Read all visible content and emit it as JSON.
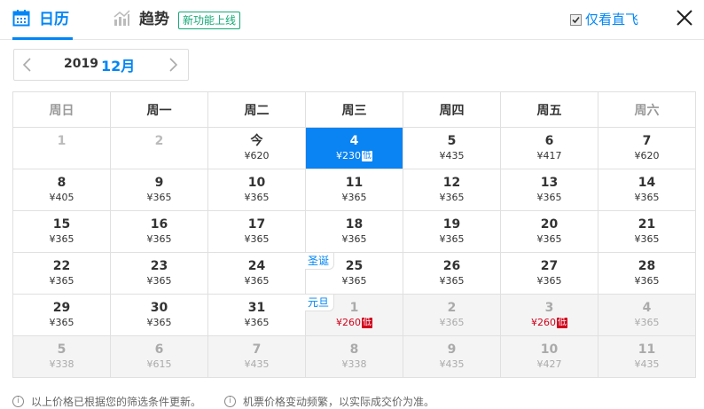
{
  "header": {
    "tab_calendar": "日历",
    "tab_trend": "趋势",
    "new_badge": "新功能上线",
    "direct_only_label": "仅看直飞",
    "direct_only_checked": true
  },
  "month_nav": {
    "year": "2019",
    "month": "12月"
  },
  "weekdays": [
    "周日",
    "周一",
    "周二",
    "周三",
    "周四",
    "周五",
    "周六"
  ],
  "weeks": [
    [
      {
        "day": "1",
        "price": ""
      },
      {
        "day": "2",
        "price": ""
      },
      {
        "day": "今",
        "price": "¥620"
      },
      {
        "day": "4",
        "price": "¥230",
        "low": "低"
      },
      {
        "day": "5",
        "price": "¥435"
      },
      {
        "day": "6",
        "price": "¥417"
      },
      {
        "day": "7",
        "price": "¥620"
      }
    ],
    [
      {
        "day": "8",
        "price": "¥405"
      },
      {
        "day": "9",
        "price": "¥365"
      },
      {
        "day": "10",
        "price": "¥365"
      },
      {
        "day": "11",
        "price": "¥365"
      },
      {
        "day": "12",
        "price": "¥365"
      },
      {
        "day": "13",
        "price": "¥365"
      },
      {
        "day": "14",
        "price": "¥365"
      }
    ],
    [
      {
        "day": "15",
        "price": "¥365"
      },
      {
        "day": "16",
        "price": "¥365"
      },
      {
        "day": "17",
        "price": "¥365"
      },
      {
        "day": "18",
        "price": "¥365"
      },
      {
        "day": "19",
        "price": "¥365"
      },
      {
        "day": "20",
        "price": "¥365"
      },
      {
        "day": "21",
        "price": "¥365"
      }
    ],
    [
      {
        "day": "22",
        "price": "¥365"
      },
      {
        "day": "23",
        "price": "¥365"
      },
      {
        "day": "24",
        "price": "¥365"
      },
      {
        "day": "25",
        "price": "¥365",
        "holiday": "圣诞"
      },
      {
        "day": "26",
        "price": "¥365"
      },
      {
        "day": "27",
        "price": "¥365"
      },
      {
        "day": "28",
        "price": "¥365"
      }
    ],
    [
      {
        "day": "29",
        "price": "¥365"
      },
      {
        "day": "30",
        "price": "¥365"
      },
      {
        "day": "31",
        "price": "¥365"
      },
      {
        "day": "1",
        "price": "¥260",
        "low": "低",
        "holiday": "元旦"
      },
      {
        "day": "2",
        "price": "¥365"
      },
      {
        "day": "3",
        "price": "¥260",
        "low": "低"
      },
      {
        "day": "4",
        "price": "¥365"
      }
    ],
    [
      {
        "day": "5",
        "price": "¥338"
      },
      {
        "day": "6",
        "price": "¥615"
      },
      {
        "day": "7",
        "price": "¥435"
      },
      {
        "day": "8",
        "price": "¥338"
      },
      {
        "day": "9",
        "price": "¥435"
      },
      {
        "day": "10",
        "price": "¥427"
      },
      {
        "day": "11",
        "price": "¥435"
      }
    ]
  ],
  "footer": {
    "note1": "以上价格已根据您的筛选条件更新。",
    "note2": "机票价格变动频繁，以实际成交价为准。"
  },
  "colors": {
    "accent": "#0086f6",
    "selected_bg": "#0a83f3",
    "low_price": "#d0021b",
    "badge_green": "#13a877"
  }
}
